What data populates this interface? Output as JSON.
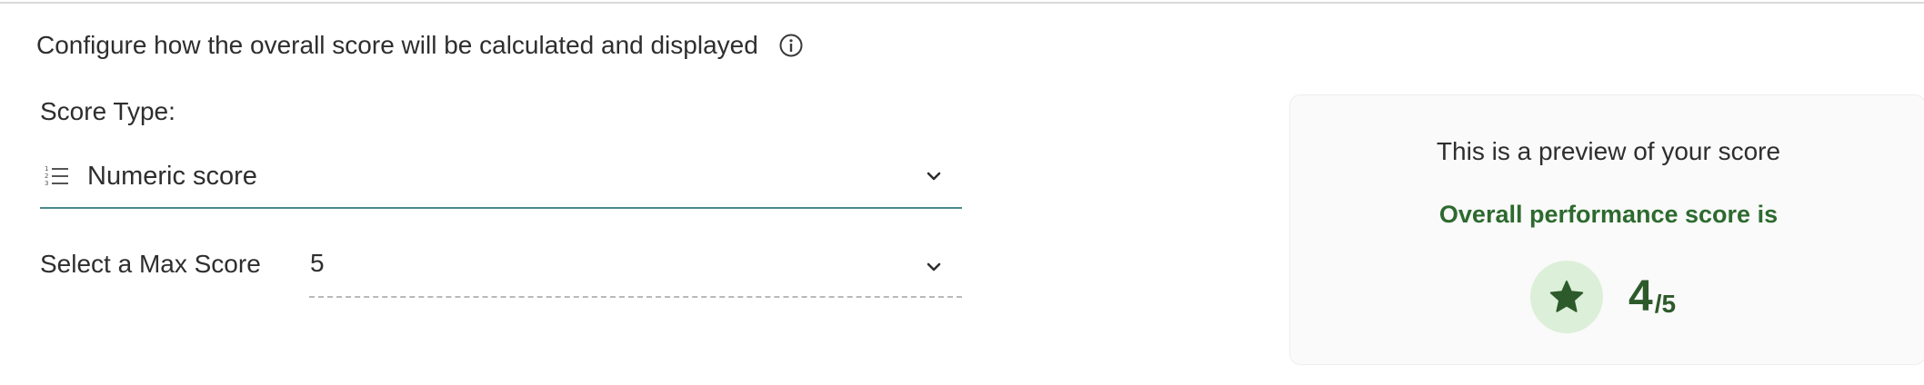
{
  "config": {
    "description": "Configure how the overall score will be calculated and displayed",
    "info_icon": "info-circle-icon"
  },
  "score_type": {
    "label": "Score Type:",
    "value": "Numeric score",
    "icon": "numbered-list-icon"
  },
  "max_score": {
    "label": "Select a Max Score",
    "value": "5"
  },
  "preview": {
    "title": "This is a preview of your score",
    "subtitle": "Overall performance score is",
    "score": "4",
    "max": "/5",
    "icon": "star-icon"
  },
  "colors": {
    "accent_underline": "#4a8a8c",
    "score_green": "#2d5a2b",
    "badge_bg": "#dcefd8"
  }
}
